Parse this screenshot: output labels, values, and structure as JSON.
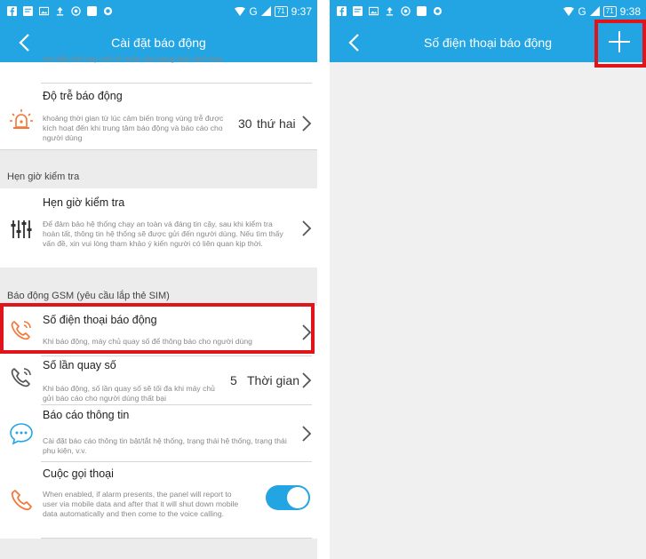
{
  "left": {
    "status": {
      "network": "G",
      "battery": "71",
      "time": "9:37"
    },
    "title": "Cài đặt báo động",
    "partial_desc": "cho đến khi máy chủ trì hoãn vào trạng thái cảnh báo.",
    "delay": {
      "title": "Độ trễ báo động",
      "desc": "khoảng thời gian từ lúc cảm biến trong vùng trễ được kích hoạt đến khi trung tâm báo động và báo cáo cho người dùng",
      "value": "30",
      "unit": "thứ hai"
    },
    "section_check": "Hẹn giờ kiểm tra",
    "check": {
      "title": "Hẹn giờ kiểm tra",
      "desc": "Để đảm bảo hệ thống chạy an toàn và đáng tin cậy, sau khi kiểm tra hoàn tất, thông tin hệ thống sẽ được gửi đến người dùng. Nếu tìm thấy vấn đề, xin vui lòng tham khảo ý kiến người có liên quan kịp thời."
    },
    "section_gsm": "Báo động GSM (yêu cầu lắp thẻ SIM)",
    "alarm_phone": {
      "title": "Số điện thoại báo động",
      "desc": "Khi báo động, máy chủ quay số để thông báo cho người dùng"
    },
    "dial_count": {
      "title": "Số lần quay số",
      "desc": "Khi báo động, số lần quay số sẽ tối đa khi máy chủ gửi báo cáo cho người dùng thất bại",
      "value": "5",
      "unit": "Thời gian"
    },
    "info_report": {
      "title": "Báo cáo thông tin",
      "desc": "Cài đặt báo cáo thông tin bật/tắt hệ thống, trạng thái hệ thống, trạng thái phụ kiện, v.v."
    },
    "voice_call": {
      "title": "Cuộc gọi thoại",
      "desc": "When enabled, if alarm presents, the panel will report to user via mobile data and after that it will shut down mobile data automatically and then come to the voice calling.",
      "enabled": true
    }
  },
  "right": {
    "status": {
      "network": "G",
      "battery": "71",
      "time": "9:38"
    },
    "title": "Số điện thoại báo động"
  },
  "colors": {
    "primary": "#23a5e3",
    "highlight": "#e0151b",
    "icon_orange": "#f2773a"
  }
}
